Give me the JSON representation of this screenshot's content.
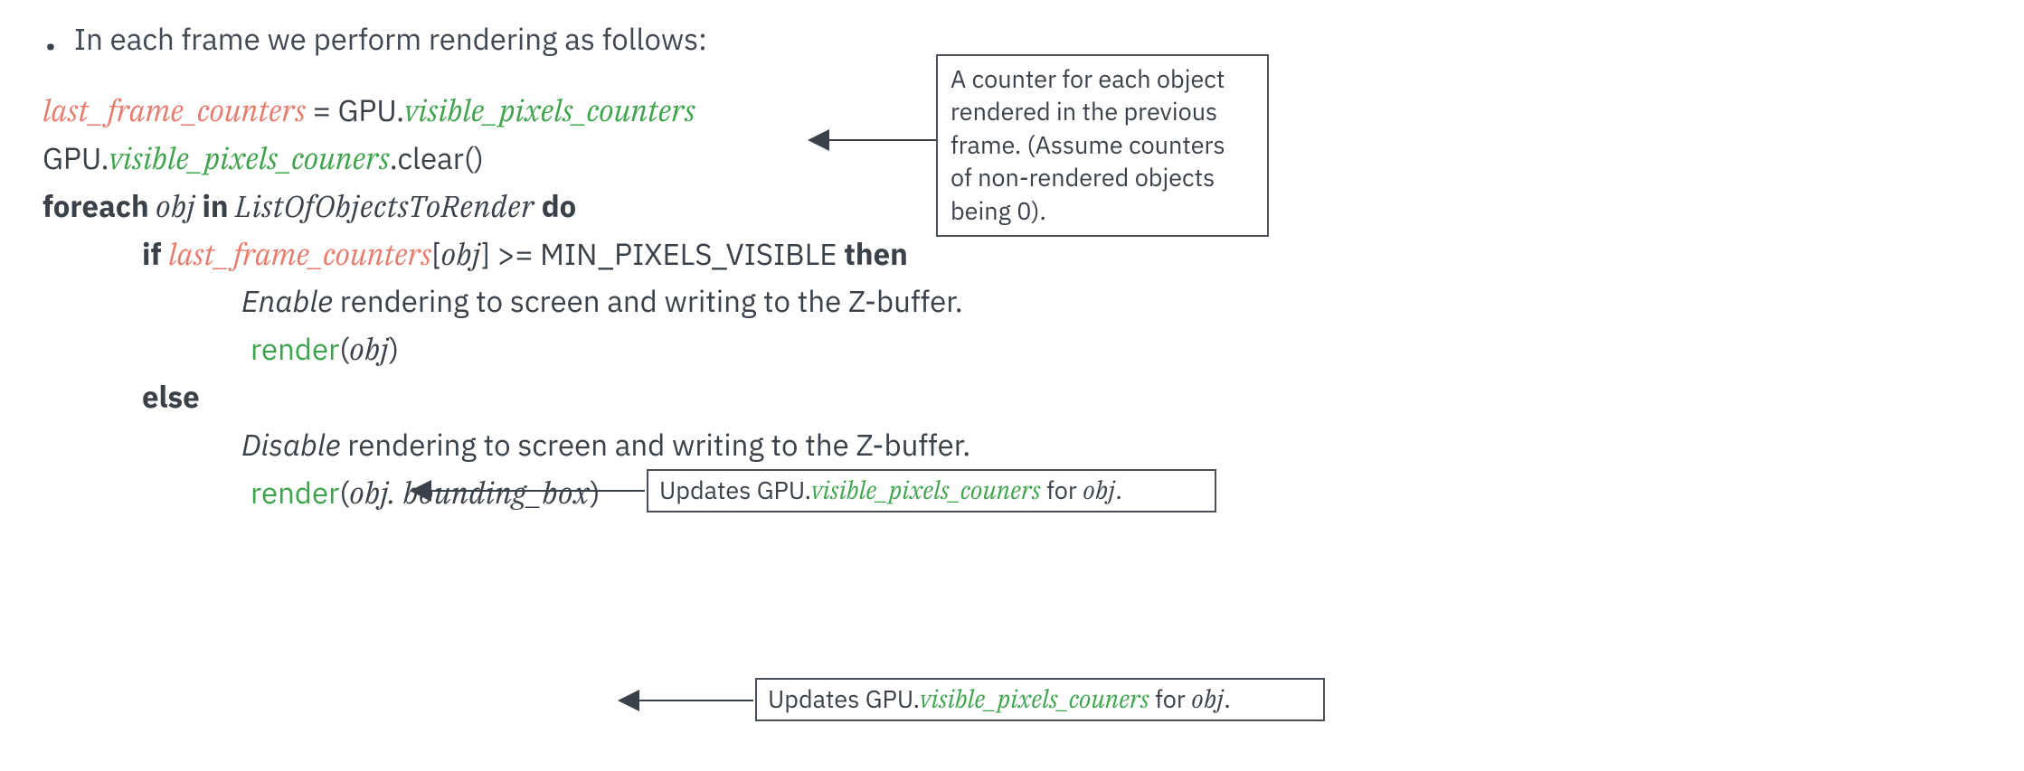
{
  "bullet_glyph": "•",
  "title": "In each frame we perform rendering as follows:",
  "line1": {
    "lfc": "last_frame_counters",
    "eq": " = GPU.",
    "vpc": "visible_pixels_counters"
  },
  "line2": {
    "gpu": "GPU.",
    "vpc": "visible_pixels_couners",
    "clear": ".clear()"
  },
  "line3": {
    "kw1": "foreach",
    "obj": " obj ",
    "kw2": "in",
    "list": " ListOfObjectsToRender ",
    "kw3": "do"
  },
  "line4": {
    "kw_if": "if ",
    "lfc": "last_frame_counters",
    "lbracket": "[",
    "obj": "obj",
    "rbracket": "] >= MIN_PIXELS_VISIBLE ",
    "kw_then": "then"
  },
  "line5": {
    "enable_it": "Enable",
    "rest": " rendering to screen and writing to the Z-buffer."
  },
  "line6": {
    "render": "render",
    "lp": "(",
    "obj": "obj",
    "rp": ")"
  },
  "line7": {
    "kw_else": "else"
  },
  "line8": {
    "disable_it": "Disable",
    "rest": " rendering to screen and writing to the Z-buffer."
  },
  "line9": {
    "render": "render",
    "lp": "(",
    "arg": "obj. bounding_box",
    "rp": ")"
  },
  "note_top": {
    "t1": "A counter for each object ",
    "t2": "rendered in the previous ",
    "t3": "frame. (Assume counters ",
    "t4": "of non-rendered objects ",
    "t5": "being 0)."
  },
  "note_render": {
    "pre": "Updates GPU.",
    "vpc": "visible_pixels_couners",
    "mid": " for ",
    "obj": "obj",
    "post": "."
  }
}
